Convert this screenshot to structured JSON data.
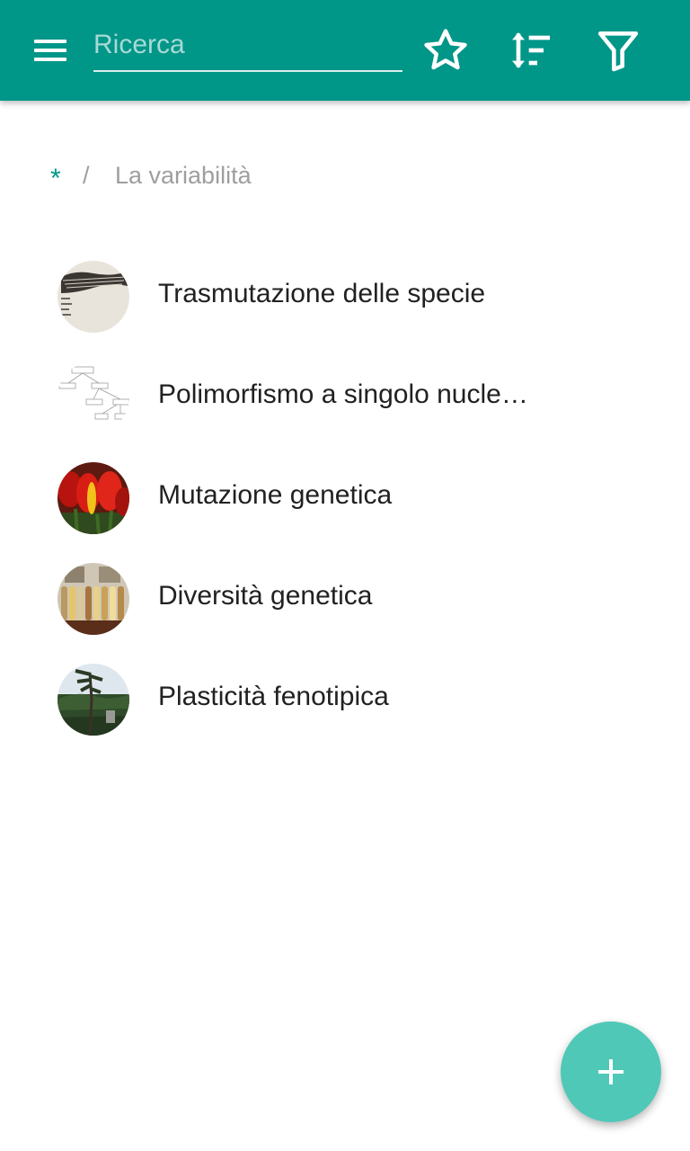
{
  "appbar": {
    "search": {
      "placeholder": "Ricerca",
      "value": ""
    },
    "icons": [
      "menu-icon",
      "star-outline-icon",
      "sort-icon",
      "filter-icon"
    ],
    "color": "#009688"
  },
  "breadcrumb": {
    "root": "*",
    "separator": "/",
    "current": "La variabilità"
  },
  "items": [
    {
      "label": "Trasmutazione delle specie",
      "thumbnail": "scientific-diagram-thumbnail"
    },
    {
      "label": "Polimorfismo a singolo nucleotide",
      "thumbnail": "flowchart-thumbnail"
    },
    {
      "label": "Mutazione genetica",
      "thumbnail": "tulips-thumbnail"
    },
    {
      "label": "Diversità genetica",
      "thumbnail": "corn-varieties-thumbnail"
    },
    {
      "label": "Plasticità fenotipica",
      "thumbnail": "windswept-tree-thumbnail"
    }
  ],
  "fab": {
    "icon": "plus-icon",
    "color": "#4fc8b8"
  }
}
